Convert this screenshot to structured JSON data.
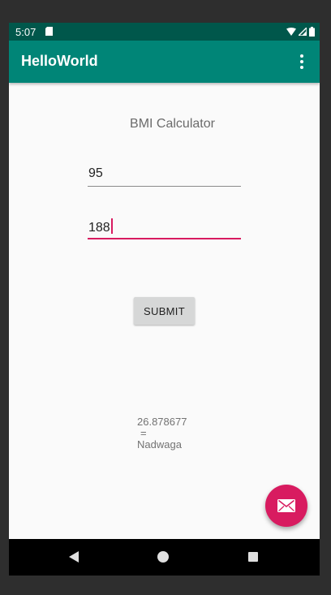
{
  "status_bar": {
    "time": "5:07",
    "icons": [
      "sd-card-icon",
      "wifi-icon",
      "cell-signal-icon",
      "battery-icon"
    ]
  },
  "app_bar": {
    "title": "HelloWorld",
    "menu_icon": "overflow-menu-icon"
  },
  "main": {
    "title": "BMI Calculator",
    "weight_value": "95",
    "height_value": "188",
    "submit_label": "SUBMIT",
    "result_lines": [
      "26.878677",
      "=",
      "Nadwaga"
    ]
  },
  "fab": {
    "icon": "email-icon"
  },
  "nav_bar": {
    "icons": [
      "back-icon",
      "home-icon",
      "recents-icon"
    ]
  },
  "colors": {
    "status_bar": "#00574b",
    "app_bar": "#008577",
    "accent": "#d81b60",
    "background": "#fafafa"
  }
}
